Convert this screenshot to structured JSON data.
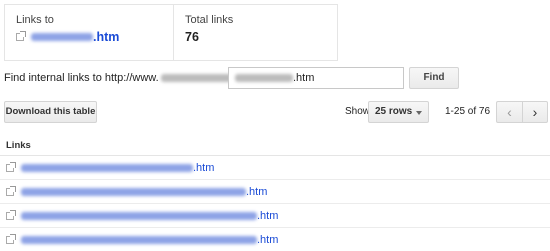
{
  "summary": {
    "links_to_label": "Links to",
    "links_to_suffix": ".htm",
    "total_label": "Total links",
    "total_value": "76"
  },
  "find": {
    "label_prefix": "Find internal links to http://www.",
    "input_suffix": ".htm",
    "button_label": "Find"
  },
  "toolbar": {
    "download_label": "Download this table",
    "show_label": "Show",
    "rows_selected": "25 rows",
    "page_range": "1-25 of 76"
  },
  "table": {
    "header": "Links",
    "rows": [
      {
        "suffix": ".htm"
      },
      {
        "suffix": ".htm"
      },
      {
        "suffix": ".htm"
      },
      {
        "suffix": ".htm"
      }
    ]
  },
  "icons": {
    "external": "external-link-icon",
    "prev": "chevron-left-icon",
    "next": "chevron-right-icon",
    "dropdown": "caret-down-icon"
  },
  "colors": {
    "link": "#1a4bd6",
    "border": "#e5e5e5",
    "button_bg": "#efefef"
  }
}
